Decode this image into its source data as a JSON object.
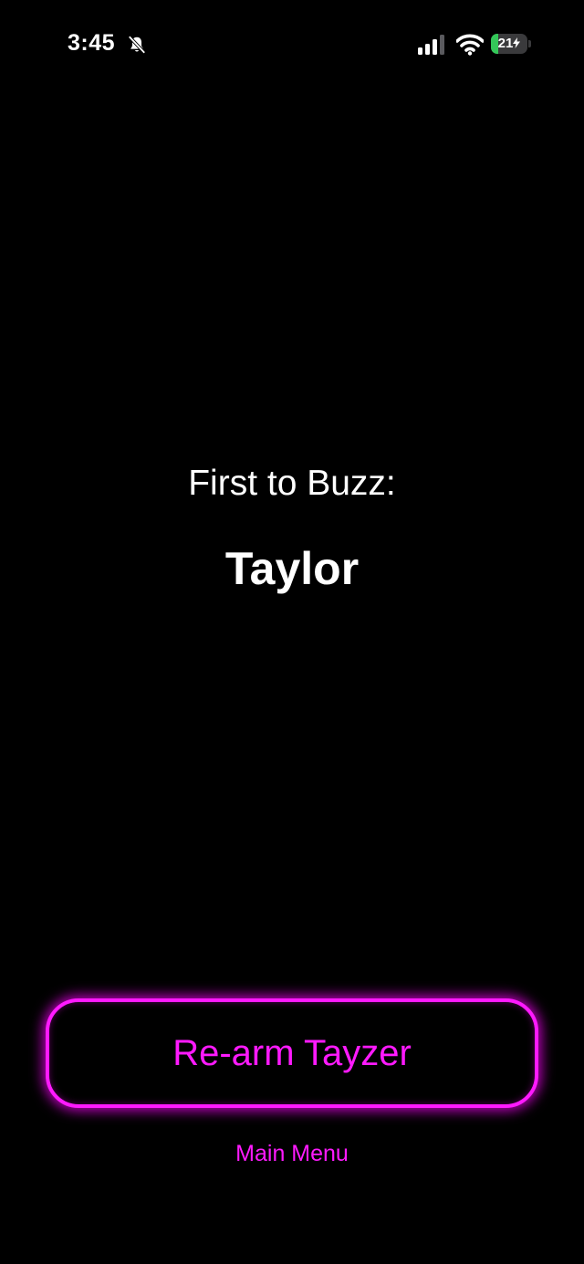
{
  "status_bar": {
    "time": "3:45",
    "bell_icon": "bell-slash-icon",
    "signal_icon": "cellular-signal-icon",
    "wifi_icon": "wifi-icon",
    "battery_level": "21",
    "battery_fill_fraction": 0.21,
    "battery_charging": true
  },
  "main": {
    "buzz_label": "First to Buzz:",
    "winner": "Taylor"
  },
  "actions": {
    "rearm_label": "Re-arm Tayzer",
    "main_menu_label": "Main Menu"
  },
  "colors": {
    "background": "#000000",
    "accent": "#ff1aff",
    "text": "#ffffff",
    "battery_green": "#34c759"
  }
}
